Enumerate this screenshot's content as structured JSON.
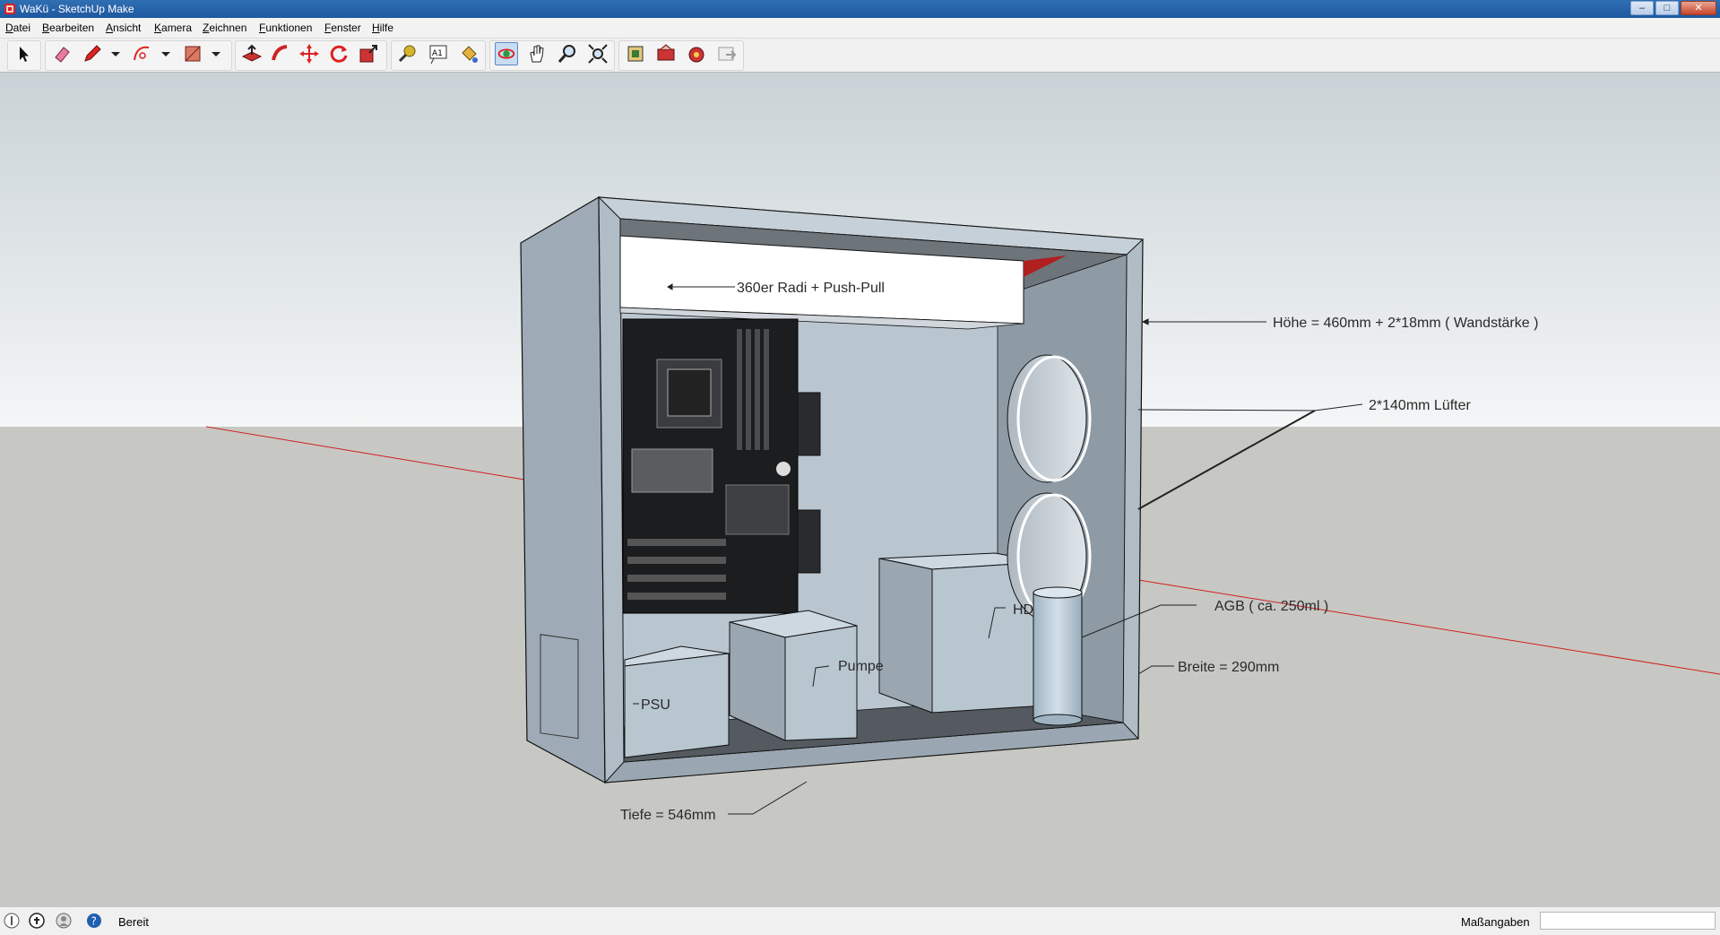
{
  "window": {
    "title": "WaKü - SketchUp Make",
    "buttons": {
      "minimize": "–",
      "maximize": "□",
      "close": "✕"
    }
  },
  "menu": [
    "Datei",
    "Bearbeiten",
    "Ansicht",
    "Kamera",
    "Zeichnen",
    "Funktionen",
    "Fenster",
    "Hilfe"
  ],
  "toolbar": {
    "tools": [
      "select-tool",
      "eraser-tool",
      "pencil-line-tool",
      "arc-tool",
      "rectangle-tool",
      "push-pull-tool",
      "follow-me-tool",
      "move-tool",
      "rotate-tool",
      "scale-tool",
      "tape-measure-tool",
      "text-tool",
      "paint-bucket-tool",
      "orbit-tool",
      "pan-tool",
      "zoom-tool",
      "zoom-extents-tool",
      "3d-warehouse-tool",
      "share-model-tool",
      "extension-warehouse-tool",
      "send-to-layout-tool"
    ],
    "active_tool": "orbit-tool",
    "text_tool_glyph": "A1"
  },
  "model": {
    "labels": {
      "radiator": "360er Radi + Push-Pull",
      "height": "Höhe = 460mm + 2*18mm ( Wandstärke )",
      "fans": "2*140mm Lüfter",
      "reservoir": "AGB ( ca. 250ml )",
      "width": "Breite = 290mm",
      "depth": "Tiefe = 546mm",
      "psu": "PSU",
      "pump": "Pumpe",
      "hdd": "HD"
    },
    "colors": {
      "sky": "#d6dde0",
      "ground": "#c7c8c3",
      "case": "#aab7c1",
      "axis_red": "#d02020"
    }
  },
  "status": {
    "text": "Bereit",
    "measurements_label": "Maßangaben",
    "measurements_value": ""
  }
}
